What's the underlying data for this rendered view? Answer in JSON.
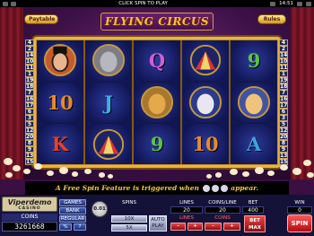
{
  "topbar": {
    "click_to_play": "CLICK SPIN TO PLAY",
    "clock": "14:51"
  },
  "header": {
    "paytable_label": "Paytable",
    "title": "FLYING CIRCUS",
    "rules_label": "Rules"
  },
  "paylines_left": [
    "4",
    "2",
    "14",
    "10",
    "11",
    "1",
    "19",
    "18",
    "7",
    "16",
    "17",
    "6",
    "3",
    "5",
    "12",
    "20",
    "8",
    "9",
    "13",
    "15"
  ],
  "paylines_right": [
    "4",
    "2",
    "14",
    "10",
    "11",
    "1",
    "19",
    "18",
    "7",
    "16",
    "17",
    "6",
    "3",
    "5",
    "12",
    "20",
    "8",
    "9",
    "13",
    "15"
  ],
  "reels": [
    [
      {
        "symbol": "ringmaster-portrait",
        "kind": "image"
      },
      {
        "symbol": "10",
        "kind": "text",
        "color": "#e88a2a"
      },
      {
        "symbol": "K",
        "kind": "text",
        "color": "#e8402f"
      }
    ],
    [
      {
        "symbol": "elephant-portrait",
        "kind": "image"
      },
      {
        "symbol": "J",
        "kind": "text",
        "color": "#3fb0e8"
      },
      {
        "symbol": "circus-tent",
        "kind": "image"
      }
    ],
    [
      {
        "symbol": "Q",
        "kind": "text",
        "color": "#d05ed8"
      },
      {
        "symbol": "lion-portrait",
        "kind": "image"
      },
      {
        "symbol": "9",
        "kind": "text",
        "color": "#58c24d"
      }
    ],
    [
      {
        "symbol": "circus-tent",
        "kind": "image"
      },
      {
        "symbol": "clown-portrait",
        "kind": "image"
      },
      {
        "symbol": "10",
        "kind": "text",
        "color": "#e88a2a"
      }
    ],
    [
      {
        "symbol": "9",
        "kind": "text",
        "color": "#58c24d"
      },
      {
        "symbol": "acrobat-woman-portrait",
        "kind": "image"
      },
      {
        "symbol": "A",
        "kind": "text",
        "color": "#3ca2e4"
      }
    ]
  ],
  "banner": {
    "text_before": "A Free Spin Feature is triggered when",
    "text_after": "appear."
  },
  "panel": {
    "logo_main": "Viperdemo",
    "logo_sub": "CASINO",
    "coins_label": "COINS",
    "coins_value": "3261668",
    "games_label": "GAMES",
    "bank_label": "BANK",
    "regular_label": "REGULAR",
    "percent_label": "%",
    "help_label": "?",
    "coin_value_label": "0.01",
    "spins_label": "SPINS",
    "spins_10x": "10X",
    "spins_5x": "5X",
    "auto_play_label": "AUTO PLAY",
    "lines_label": "LINES",
    "lines_value": "20",
    "coins_line_label": "COINS/LINE",
    "coins_line_value": "20",
    "bet_label": "BET",
    "bet_value": "400",
    "win_label": "WIN",
    "win_value": "0",
    "lines_btn_label": "LINES",
    "coins_btn_label": "COINS",
    "minus": "-",
    "plus": "+",
    "bet_max_label": "BET MAX",
    "spin_label": "SPIN"
  },
  "colors": {
    "title_gold": "#f3c233",
    "frame_gold": "#e5b546",
    "stage_purple": "#3a0f42",
    "spin_red": "#d81d20"
  }
}
